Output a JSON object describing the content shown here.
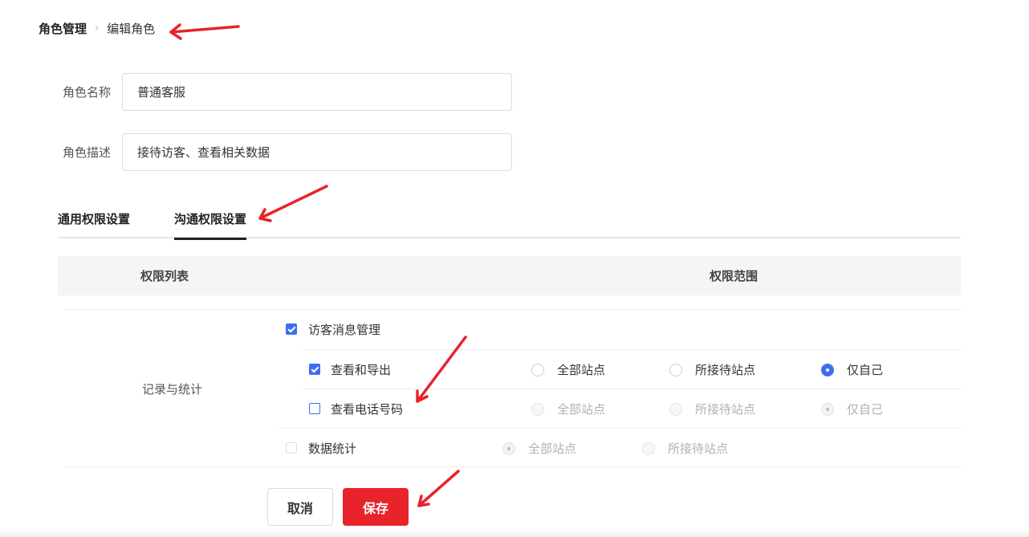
{
  "breadcrumb": {
    "root": "角色管理",
    "separator": "›",
    "current": "编辑角色"
  },
  "form": {
    "name": {
      "label": "角色名称",
      "value": "普通客服"
    },
    "description": {
      "label": "角色描述",
      "value": "接待访客、查看相关数据"
    }
  },
  "tabs": [
    {
      "label": "通用权限设置",
      "active": false
    },
    {
      "label": "沟通权限设置",
      "active": true
    }
  ],
  "table": {
    "headers": {
      "list": "权限列表",
      "scope": "权限范围"
    },
    "group": "记录与统计",
    "rows": [
      {
        "label": "访客消息管理",
        "checked": true
      },
      {
        "label": "查看和导出",
        "checked": true,
        "options": [
          "全部站点",
          "所接待站点",
          "仅自己"
        ],
        "selected": "仅自己"
      },
      {
        "label": "查看电话号码",
        "checked": false,
        "options": [
          "全部站点",
          "所接待站点",
          "仅自己"
        ],
        "selected": "仅自己",
        "disabled": true
      },
      {
        "label": "数据统计",
        "checked": false,
        "options": [
          "全部站点",
          "所接待站点"
        ],
        "selected": "全部站点",
        "disabled": true
      }
    ]
  },
  "actions": {
    "cancel": "取消",
    "save": "保存"
  },
  "colors": {
    "primary": "#3e6ef0",
    "save": "#e8232a",
    "annotation": "#e8232a"
  }
}
